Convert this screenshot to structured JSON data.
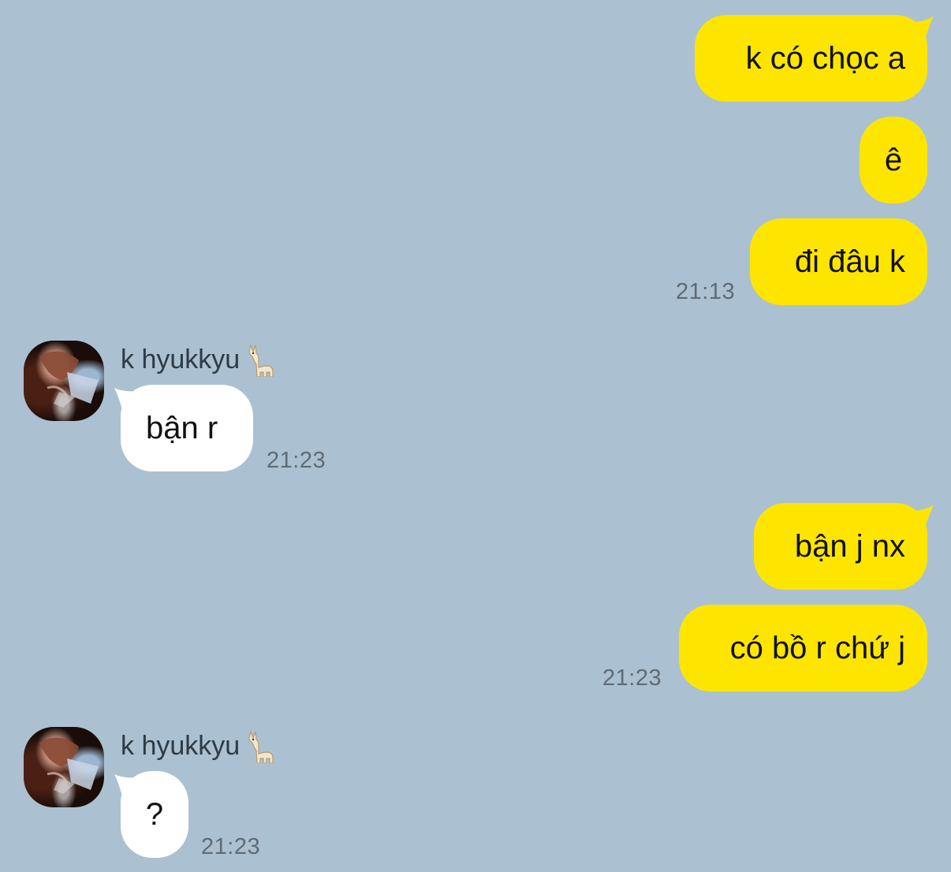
{
  "conversation": {
    "contact_name": "k hyukkyu",
    "contact_emoji": "llama-icon",
    "colors": {
      "background": "#abc1d1",
      "my_bubble": "#fee500",
      "their_bubble": "#ffffff"
    },
    "messages": [
      {
        "id": "m1",
        "sender": "me",
        "text": "k có chọc a"
      },
      {
        "id": "m2",
        "sender": "me",
        "text": "ê"
      },
      {
        "id": "m3",
        "sender": "me",
        "text": "đi đâu k",
        "time": "21:13"
      },
      {
        "id": "m4",
        "sender": "k hyukkyu",
        "text": "bận r",
        "time": "21:23"
      },
      {
        "id": "m5",
        "sender": "me",
        "text": "bận j nx"
      },
      {
        "id": "m6",
        "sender": "me",
        "text": "có bồ r chứ j",
        "time": "21:23"
      },
      {
        "id": "m7",
        "sender": "k hyukkyu",
        "text": "?",
        "time": "21:23"
      }
    ]
  }
}
